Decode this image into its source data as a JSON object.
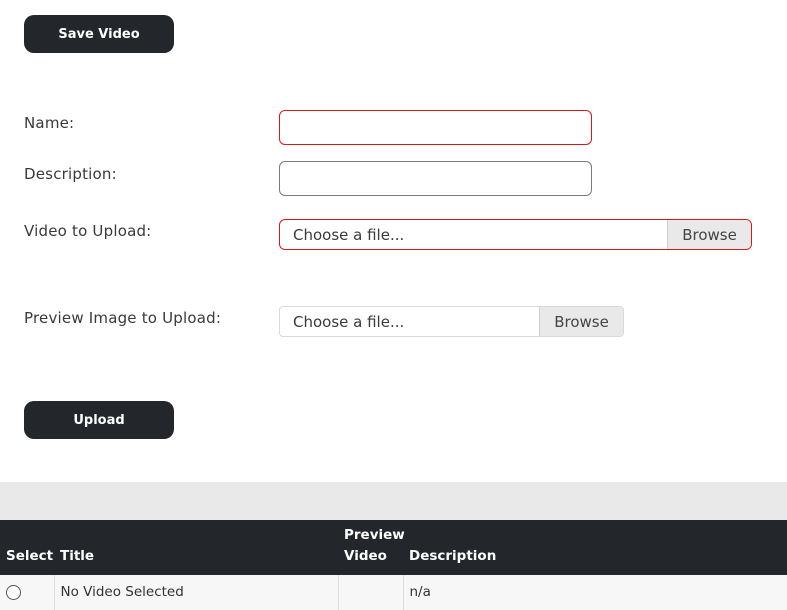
{
  "toolbar": {
    "save_label": "Save Video"
  },
  "form": {
    "name_label": "Name:",
    "name_value": "",
    "description_label": "Description:",
    "description_value": "",
    "video_label": "Video to Upload:",
    "video_placeholder": "Choose a file...",
    "video_browse": "Browse",
    "preview_label": "Preview Image to Upload:",
    "preview_placeholder": "Choose a file...",
    "preview_browse": "Browse",
    "upload_label": "Upload"
  },
  "table": {
    "headers": [
      "Select",
      "Title",
      "Preview Video",
      "Description"
    ],
    "rows": [
      {
        "title": "No Video Selected",
        "preview": "",
        "description": "n/a"
      }
    ]
  },
  "colors": {
    "dark": "#23262b",
    "invalid_border": "#d21b1b",
    "band": "#e9e9e9"
  },
  "icons": {
    "select_radio": "radio-button-icon"
  }
}
